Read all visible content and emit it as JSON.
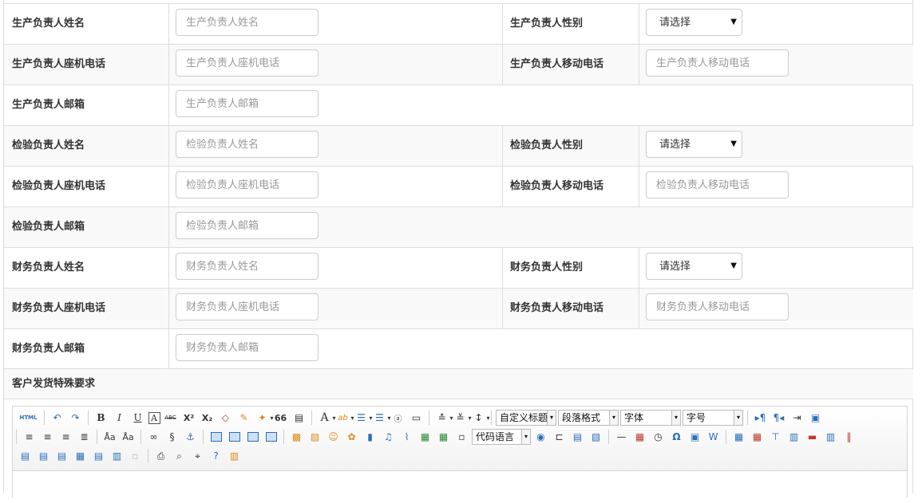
{
  "gender_options": {
    "selected": "请选择"
  },
  "rows": [
    {
      "l1": "生产负责人姓名",
      "p1": "生产负责人姓名",
      "l2": "生产负责人性别",
      "type2": "select"
    },
    {
      "l1": "生产负责人座机电话",
      "p1": "生产负责人座机电话",
      "l2": "生产负责人移动电话",
      "p2": "生产负责人移动电话",
      "type2": "input"
    },
    {
      "l1": "生产负责人邮箱",
      "p1": "生产负责人邮箱"
    },
    {
      "l1": "检验负责人姓名",
      "p1": "检验负责人姓名",
      "l2": "检验负责人性别",
      "type2": "select"
    },
    {
      "l1": "检验负责人座机电话",
      "p1": "检验负责人座机电话",
      "l2": "检验负责人移动电话",
      "p2": "检验负责人移动电话",
      "type2": "input"
    },
    {
      "l1": "检验负责人邮箱",
      "p1": "检验负责人邮箱"
    },
    {
      "l1": "财务负责人姓名",
      "p1": "财务负责人姓名",
      "l2": "财务负责人性别",
      "type2": "select"
    },
    {
      "l1": "财务负责人座机电话",
      "p1": "财务负责人座机电话",
      "l2": "财务负责人移动电话",
      "p2": "财务负责人移动电话",
      "type2": "input"
    },
    {
      "l1": "财务负责人邮箱",
      "p1": "财务负责人邮箱"
    }
  ],
  "special_section": {
    "label": "客户发货特殊要求"
  },
  "editor": {
    "html_button": "HTML",
    "combos": {
      "custom_heading": "自定义标题",
      "paragraph": "段落格式",
      "font": "字体",
      "font_size": "字号",
      "code_lang": "代码语言"
    },
    "icons": {
      "bold": "B",
      "italic": "I",
      "underline": "U",
      "font_border": "A",
      "strike": "ABC",
      "superscript": "X²",
      "subscript": "X₂",
      "quote": "66",
      "font_color": "A",
      "back_color": "ab",
      "special_char": "Ω",
      "emotion": "☺",
      "horizontal": "—"
    }
  }
}
